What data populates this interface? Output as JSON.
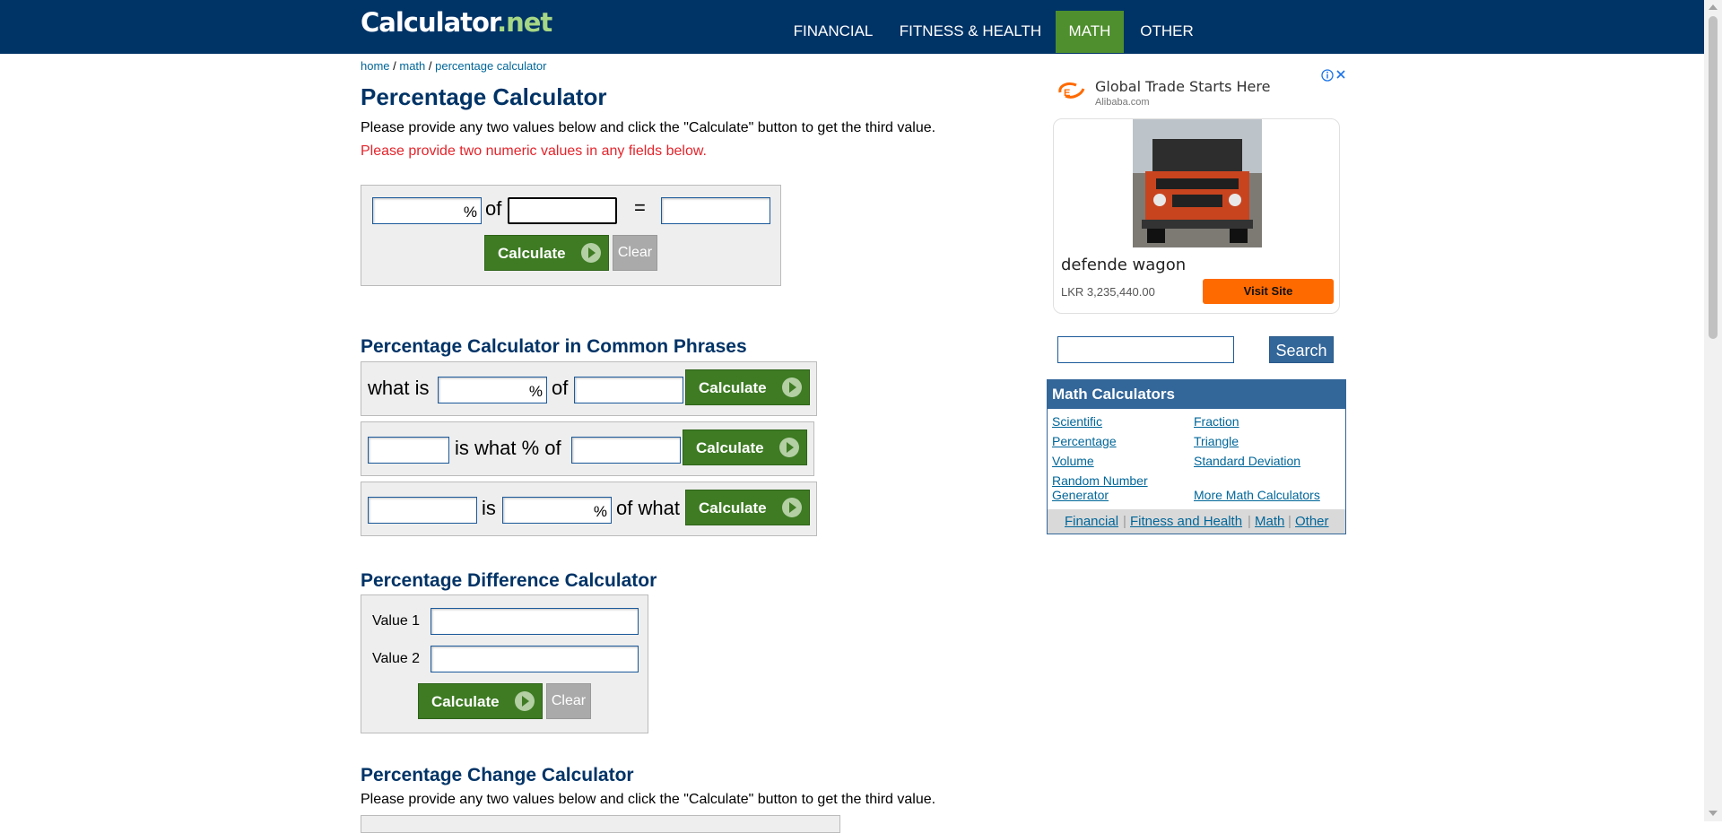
{
  "header": {
    "logo_main": "Calculator",
    "logo_net": ".net",
    "nav": [
      "FINANCIAL",
      "FITNESS & HEALTH",
      "MATH",
      "OTHER"
    ],
    "active_nav": "MATH"
  },
  "breadcrumb": {
    "home": "home",
    "sep": " / ",
    "math": "math",
    "current": "percentage calculator"
  },
  "main": {
    "title": "Percentage Calculator",
    "intro": "Please provide any two values below and click the \"Calculate\" button to get the third value.",
    "error": "Please provide two numeric values in any fields below.",
    "calc": {
      "pct": "%",
      "of": "of",
      "eq": "=",
      "calculate": "Calculate",
      "clear": "Clear"
    },
    "phrases": {
      "title": "Percentage Calculator in Common Phrases",
      "row1": {
        "what_is": "what is",
        "pct": "%",
        "of": "of",
        "calculate": "Calculate"
      },
      "row2": {
        "is_what_pct_of": "is what % of",
        "calculate": "Calculate"
      },
      "row3": {
        "is": "is",
        "pct": "%",
        "of_what": "of what",
        "calculate": "Calculate"
      }
    },
    "difference": {
      "title": "Percentage Difference Calculator",
      "value1": "Value 1",
      "value2": "Value 2",
      "calculate": "Calculate",
      "clear": "Clear"
    },
    "change": {
      "title": "Percentage Change Calculator",
      "intro": "Please provide any two values below and click the \"Calculate\" button to get the third value."
    }
  },
  "ad": {
    "brand": "Global Trade Starts Here",
    "site": "Alibaba.com",
    "product": "defende wagon",
    "price": "LKR 3,235,440.00",
    "visit": "Visit Site"
  },
  "sidebar": {
    "search_button": "Search",
    "math_title": "Math Calculators",
    "links": [
      "Scientific",
      "Fraction",
      "Percentage",
      "Triangle",
      "Volume",
      "Standard Deviation",
      "Random Number",
      "Generator",
      "More Math Calculators"
    ],
    "footer": [
      "Financial",
      "Fitness and Health",
      "Math",
      "Other"
    ],
    "footer_sep": "|"
  },
  "colors": {
    "brand": "#003366",
    "accent_green": "#4f8f2e",
    "button_green": "#3e7b23",
    "error": "#e3242b",
    "link": "#006699"
  }
}
